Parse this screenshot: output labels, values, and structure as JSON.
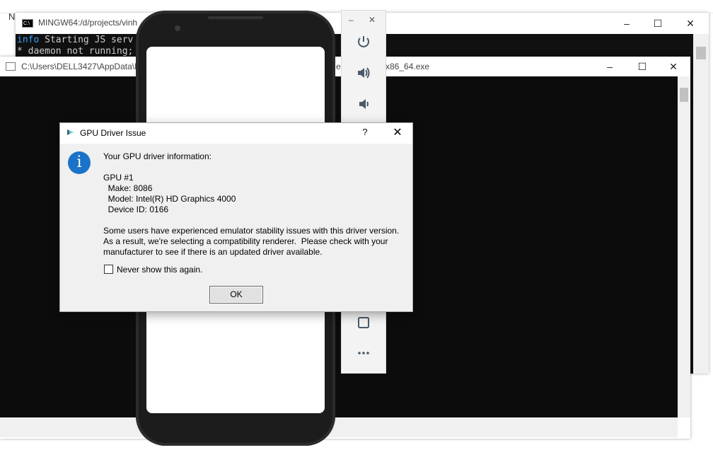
{
  "background_explorer": {
    "partial_label": "N"
  },
  "mingw_window": {
    "title": "MINGW64:/d/projects/vinh",
    "icon": "terminal-icon",
    "lines": [
      {
        "prefix": "info",
        "text": " Starting JS serv"
      },
      {
        "prefix": "",
        "text": "* daemon not running;"
      }
    ]
  },
  "cmd_window": {
    "title_left": "C:\\Users\\DELL3427\\AppData\\L",
    "title_right": "x86_64.exe",
    "title_fragment": "e",
    "icon": "console-icon"
  },
  "emulator_toolbar": {
    "buttons": [
      "power-icon",
      "volume-up-icon",
      "volume-down-icon",
      "overview-icon",
      "more-icon"
    ],
    "minimize": "–",
    "close": "✕"
  },
  "dialog": {
    "title": "GPU Driver Issue",
    "help": "?",
    "close": "✕",
    "heading": "Your GPU driver information:",
    "gpu_label": "GPU #1",
    "make": "  Make: 8086",
    "model": "  Model: Intel(R) HD Graphics 4000",
    "device_id": "  Device ID: 0166",
    "message_1": "Some users have experienced emulator stability issues with this driver version.",
    "message_2": "As a result, we're selecting a compatibility renderer.  Please check with your",
    "message_3": "manufacturer to see if there is an updated driver available.",
    "checkbox_label": "Never show this again.",
    "ok_label": "OK"
  },
  "colors": {
    "info_accent": "#1a73c9",
    "terminal_bg": "#0c0c0c",
    "info_text": "#3aa0ff"
  }
}
